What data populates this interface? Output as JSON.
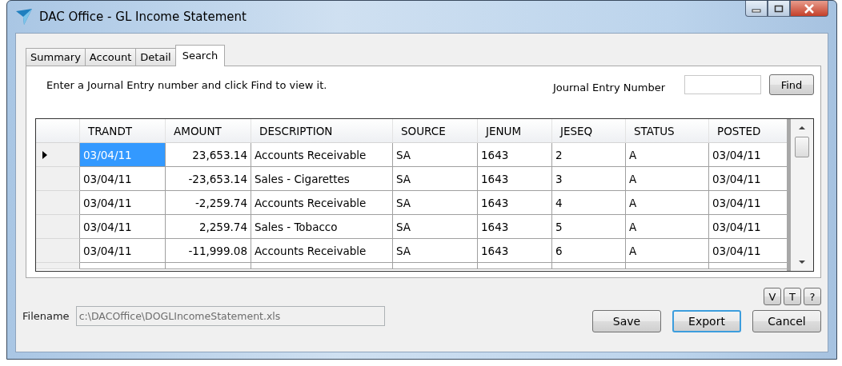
{
  "window": {
    "title": "DAC Office - GL Income Statement"
  },
  "tabs": [
    {
      "label": "Summary",
      "selected": false
    },
    {
      "label": "Account",
      "selected": false
    },
    {
      "label": "Detail",
      "selected": false
    },
    {
      "label": "Search",
      "selected": true
    }
  ],
  "search": {
    "instructions": "Enter a Journal Entry number and click Find to view it.",
    "field_label": "Journal Entry Number",
    "button": "Find"
  },
  "grid": {
    "columns": [
      "TRANDT",
      "AMOUNT",
      "DESCRIPTION",
      "SOURCE",
      "JENUM",
      "JESEQ",
      "STATUS",
      "POSTED"
    ],
    "rows": [
      {
        "selected": true,
        "cells": [
          "03/04/11",
          "23,653.14",
          "Accounts Receivable",
          "SA",
          "1643",
          "2",
          "A",
          "03/04/11"
        ]
      },
      {
        "selected": false,
        "cells": [
          "03/04/11",
          "-23,653.14",
          "Sales - Cigarettes",
          "SA",
          "1643",
          "3",
          "A",
          "03/04/11"
        ]
      },
      {
        "selected": false,
        "cells": [
          "03/04/11",
          "-2,259.74",
          "Accounts Receivable",
          "SA",
          "1643",
          "4",
          "A",
          "03/04/11"
        ]
      },
      {
        "selected": false,
        "cells": [
          "03/04/11",
          "2,259.74",
          "Sales - Tobacco",
          "SA",
          "1643",
          "5",
          "A",
          "03/04/11"
        ]
      },
      {
        "selected": false,
        "cells": [
          "03/04/11",
          "-11,999.08",
          "Accounts Receivable",
          "SA",
          "1643",
          "6",
          "A",
          "03/04/11"
        ]
      }
    ]
  },
  "small_buttons": [
    "V",
    "T",
    "?"
  ],
  "filename": {
    "label": "Filename",
    "value": "c:\\DACOffice\\DOGLIncomeStatement.xls",
    "disabled": true
  },
  "buttons": [
    {
      "label": "Save",
      "focused": false
    },
    {
      "label": "Export",
      "focused": true
    },
    {
      "label": "Cancel",
      "focused": false
    }
  ]
}
